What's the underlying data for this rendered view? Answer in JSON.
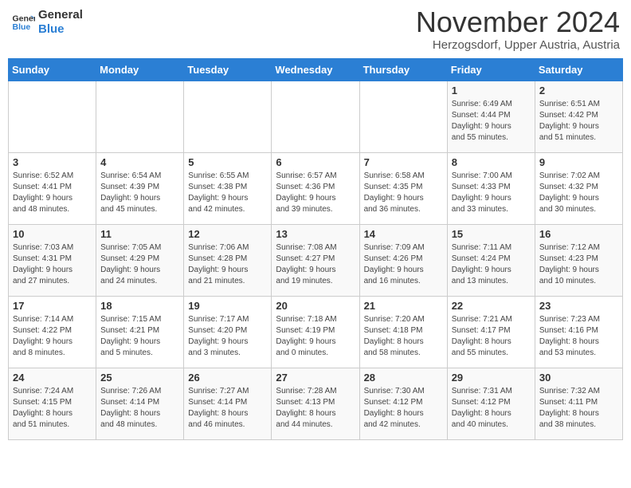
{
  "logo": {
    "line1": "General",
    "line2": "Blue"
  },
  "title": "November 2024",
  "location": "Herzogsdorf, Upper Austria, Austria",
  "days_of_week": [
    "Sunday",
    "Monday",
    "Tuesday",
    "Wednesday",
    "Thursday",
    "Friday",
    "Saturday"
  ],
  "weeks": [
    [
      {
        "day": "",
        "info": ""
      },
      {
        "day": "",
        "info": ""
      },
      {
        "day": "",
        "info": ""
      },
      {
        "day": "",
        "info": ""
      },
      {
        "day": "",
        "info": ""
      },
      {
        "day": "1",
        "info": "Sunrise: 6:49 AM\nSunset: 4:44 PM\nDaylight: 9 hours\nand 55 minutes."
      },
      {
        "day": "2",
        "info": "Sunrise: 6:51 AM\nSunset: 4:42 PM\nDaylight: 9 hours\nand 51 minutes."
      }
    ],
    [
      {
        "day": "3",
        "info": "Sunrise: 6:52 AM\nSunset: 4:41 PM\nDaylight: 9 hours\nand 48 minutes."
      },
      {
        "day": "4",
        "info": "Sunrise: 6:54 AM\nSunset: 4:39 PM\nDaylight: 9 hours\nand 45 minutes."
      },
      {
        "day": "5",
        "info": "Sunrise: 6:55 AM\nSunset: 4:38 PM\nDaylight: 9 hours\nand 42 minutes."
      },
      {
        "day": "6",
        "info": "Sunrise: 6:57 AM\nSunset: 4:36 PM\nDaylight: 9 hours\nand 39 minutes."
      },
      {
        "day": "7",
        "info": "Sunrise: 6:58 AM\nSunset: 4:35 PM\nDaylight: 9 hours\nand 36 minutes."
      },
      {
        "day": "8",
        "info": "Sunrise: 7:00 AM\nSunset: 4:33 PM\nDaylight: 9 hours\nand 33 minutes."
      },
      {
        "day": "9",
        "info": "Sunrise: 7:02 AM\nSunset: 4:32 PM\nDaylight: 9 hours\nand 30 minutes."
      }
    ],
    [
      {
        "day": "10",
        "info": "Sunrise: 7:03 AM\nSunset: 4:31 PM\nDaylight: 9 hours\nand 27 minutes."
      },
      {
        "day": "11",
        "info": "Sunrise: 7:05 AM\nSunset: 4:29 PM\nDaylight: 9 hours\nand 24 minutes."
      },
      {
        "day": "12",
        "info": "Sunrise: 7:06 AM\nSunset: 4:28 PM\nDaylight: 9 hours\nand 21 minutes."
      },
      {
        "day": "13",
        "info": "Sunrise: 7:08 AM\nSunset: 4:27 PM\nDaylight: 9 hours\nand 19 minutes."
      },
      {
        "day": "14",
        "info": "Sunrise: 7:09 AM\nSunset: 4:26 PM\nDaylight: 9 hours\nand 16 minutes."
      },
      {
        "day": "15",
        "info": "Sunrise: 7:11 AM\nSunset: 4:24 PM\nDaylight: 9 hours\nand 13 minutes."
      },
      {
        "day": "16",
        "info": "Sunrise: 7:12 AM\nSunset: 4:23 PM\nDaylight: 9 hours\nand 10 minutes."
      }
    ],
    [
      {
        "day": "17",
        "info": "Sunrise: 7:14 AM\nSunset: 4:22 PM\nDaylight: 9 hours\nand 8 minutes."
      },
      {
        "day": "18",
        "info": "Sunrise: 7:15 AM\nSunset: 4:21 PM\nDaylight: 9 hours\nand 5 minutes."
      },
      {
        "day": "19",
        "info": "Sunrise: 7:17 AM\nSunset: 4:20 PM\nDaylight: 9 hours\nand 3 minutes."
      },
      {
        "day": "20",
        "info": "Sunrise: 7:18 AM\nSunset: 4:19 PM\nDaylight: 9 hours\nand 0 minutes."
      },
      {
        "day": "21",
        "info": "Sunrise: 7:20 AM\nSunset: 4:18 PM\nDaylight: 8 hours\nand 58 minutes."
      },
      {
        "day": "22",
        "info": "Sunrise: 7:21 AM\nSunset: 4:17 PM\nDaylight: 8 hours\nand 55 minutes."
      },
      {
        "day": "23",
        "info": "Sunrise: 7:23 AM\nSunset: 4:16 PM\nDaylight: 8 hours\nand 53 minutes."
      }
    ],
    [
      {
        "day": "24",
        "info": "Sunrise: 7:24 AM\nSunset: 4:15 PM\nDaylight: 8 hours\nand 51 minutes."
      },
      {
        "day": "25",
        "info": "Sunrise: 7:26 AM\nSunset: 4:14 PM\nDaylight: 8 hours\nand 48 minutes."
      },
      {
        "day": "26",
        "info": "Sunrise: 7:27 AM\nSunset: 4:14 PM\nDaylight: 8 hours\nand 46 minutes."
      },
      {
        "day": "27",
        "info": "Sunrise: 7:28 AM\nSunset: 4:13 PM\nDaylight: 8 hours\nand 44 minutes."
      },
      {
        "day": "28",
        "info": "Sunrise: 7:30 AM\nSunset: 4:12 PM\nDaylight: 8 hours\nand 42 minutes."
      },
      {
        "day": "29",
        "info": "Sunrise: 7:31 AM\nSunset: 4:12 PM\nDaylight: 8 hours\nand 40 minutes."
      },
      {
        "day": "30",
        "info": "Sunrise: 7:32 AM\nSunset: 4:11 PM\nDaylight: 8 hours\nand 38 minutes."
      }
    ]
  ]
}
